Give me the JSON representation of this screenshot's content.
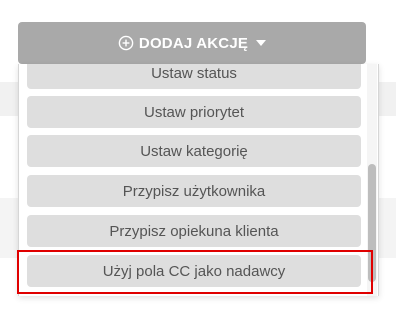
{
  "header": {
    "add_action_label": "DODAJ AKCJĘ",
    "plus_icon": "plus-circle-icon",
    "caret_icon": "caret-down-icon"
  },
  "dropdown": {
    "items": [
      {
        "label": "Ustaw status"
      },
      {
        "label": "Ustaw priorytet"
      },
      {
        "label": "Ustaw kategorię"
      },
      {
        "label": "Przypisz użytkownika"
      },
      {
        "label": "Przypisz opiekuna klienta"
      },
      {
        "label": "Użyj pola CC jako nadawcy"
      }
    ],
    "highlighted_index": 5
  },
  "colors": {
    "button_bg": "#a9a9a9",
    "item_bg": "#dedede",
    "item_text": "#555555",
    "highlight": "#e00000"
  }
}
